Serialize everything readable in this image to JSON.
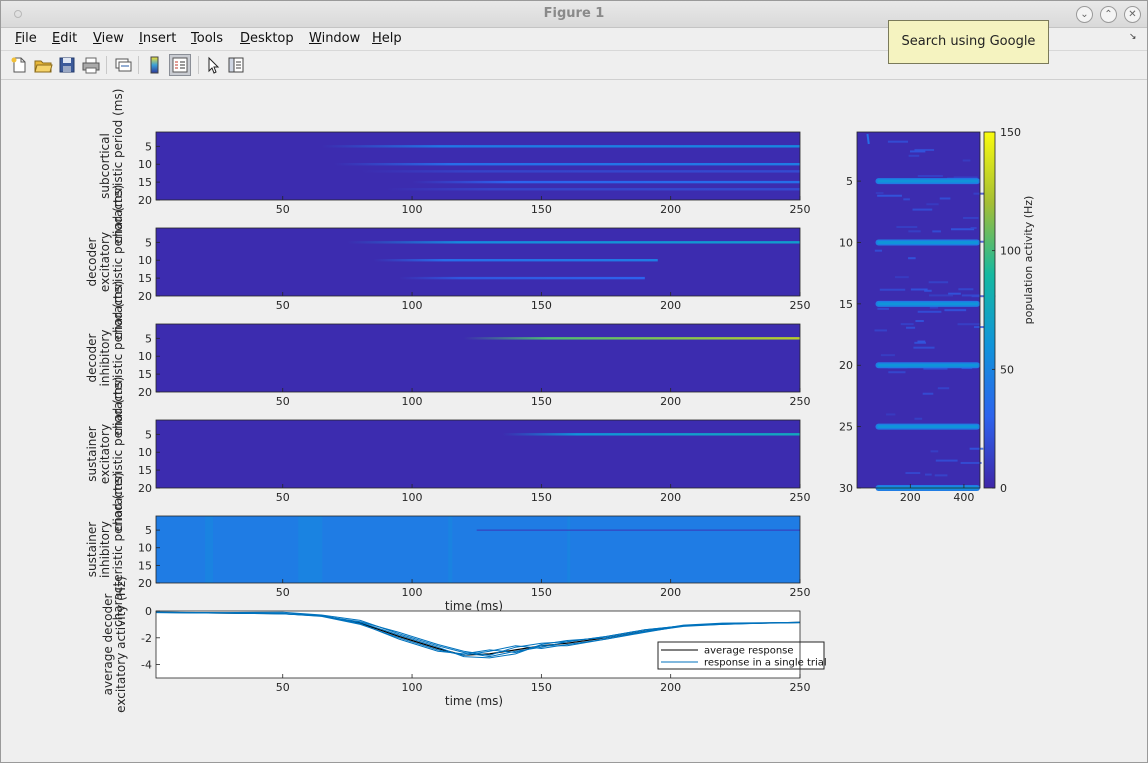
{
  "window": {
    "title": "Figure 1"
  },
  "menu": [
    {
      "label": "File",
      "u": "F",
      "rest": "ile"
    },
    {
      "label": "Edit",
      "u": "E",
      "rest": "dit"
    },
    {
      "label": "View",
      "u": "V",
      "rest": "iew"
    },
    {
      "label": "Insert",
      "u": "I",
      "rest": "nsert"
    },
    {
      "label": "Tools",
      "u": "T",
      "rest": "ools"
    },
    {
      "label": "Desktop",
      "u": "D",
      "rest": "esktop"
    },
    {
      "label": "Window",
      "u": "W",
      "rest": "indow"
    },
    {
      "label": "Help",
      "u": "H",
      "rest": "elp"
    }
  ],
  "toolbar": [
    "new-figure-icon",
    "open-file-icon",
    "save-icon",
    "print-icon",
    "link-axes-icon",
    "colorbar-icon",
    "legend-icon",
    "edit-plot-arrow-icon",
    "property-inspector-icon"
  ],
  "tooltip": {
    "text": "Search using Google"
  },
  "colors": {
    "low": "#3e26a8",
    "high": "#f9fb0e",
    "line_avg": "#000000",
    "line_trial": "#0072bd"
  },
  "chart_data": [
    {
      "type": "heatmap",
      "ylabel": [
        "subcortical",
        "characteristic period (ms)"
      ],
      "x_ticks": [
        50,
        100,
        150,
        200,
        250
      ],
      "y_ticks": [
        5,
        10,
        15,
        20
      ],
      "xlim": [
        1,
        250
      ],
      "ylim": [
        20,
        1
      ],
      "bands": [
        {
          "y": 5,
          "x_start": 65,
          "x_end": 250,
          "level": 0.35
        },
        {
          "y": 10,
          "x_start": 70,
          "x_end": 250,
          "level": 0.3
        },
        {
          "y": 12,
          "x_start": 80,
          "x_end": 250,
          "level": 0.12
        },
        {
          "y": 15,
          "x_start": 100,
          "x_end": 250,
          "level": 0.25
        },
        {
          "y": 17,
          "x_start": 90,
          "x_end": 250,
          "level": 0.12
        }
      ]
    },
    {
      "type": "heatmap",
      "ylabel": [
        "decoder",
        "excitatory",
        "characteristic period (ms)"
      ],
      "x_ticks": [
        50,
        100,
        150,
        200,
        250
      ],
      "y_ticks": [
        5,
        10,
        15,
        20
      ],
      "xlim": [
        1,
        250
      ],
      "ylim": [
        20,
        1
      ],
      "bands": [
        {
          "y": 5,
          "x_start": 75,
          "x_end": 250,
          "level": 0.45
        },
        {
          "y": 10,
          "x_start": 85,
          "x_end": 195,
          "level": 0.3
        },
        {
          "y": 15,
          "x_start": 95,
          "x_end": 190,
          "level": 0.2
        }
      ]
    },
    {
      "type": "heatmap",
      "ylabel": [
        "decoder",
        "inhibitory",
        "characteristic period (ms)"
      ],
      "x_ticks": [
        50,
        100,
        150,
        200,
        250
      ],
      "y_ticks": [
        5,
        10,
        15,
        20
      ],
      "xlim": [
        1,
        250
      ],
      "ylim": [
        20,
        1
      ],
      "bands": [
        {
          "y": 5,
          "x_start": 120,
          "x_end": 250,
          "level": 0.85
        }
      ]
    },
    {
      "type": "heatmap",
      "ylabel": [
        "sustainer",
        "excitatory",
        "characteristic period (ms)"
      ],
      "x_ticks": [
        50,
        100,
        150,
        200,
        250
      ],
      "y_ticks": [
        5,
        10,
        15,
        20
      ],
      "xlim": [
        1,
        250
      ],
      "ylim": [
        20,
        1
      ],
      "bands": [
        {
          "y": 5,
          "x_start": 135,
          "x_end": 250,
          "level": 0.5
        }
      ]
    },
    {
      "type": "heatmap",
      "ylabel": [
        "sustainer",
        "inhibitory",
        "characteristic period (ms)"
      ],
      "xlabel": "time (ms)",
      "x_ticks": [
        50,
        100,
        150,
        200,
        250
      ],
      "y_ticks": [
        5,
        10,
        15,
        20
      ],
      "xlim": [
        1,
        250
      ],
      "ylim": [
        20,
        1
      ],
      "background_level": 0.3
    },
    {
      "type": "line",
      "ylabel": [
        "average decoder",
        "excitatory activity (Hz)"
      ],
      "xlabel": "time (ms)",
      "x_ticks": [
        50,
        100,
        150,
        200,
        250
      ],
      "y_ticks": [
        0,
        -2,
        -4
      ],
      "xlim": [
        1,
        250
      ],
      "ylim": [
        -5,
        0
      ],
      "legend": {
        "position": "lower-right",
        "entries": [
          "average response",
          "response in a single trial"
        ]
      },
      "x": [
        1,
        25,
        50,
        65,
        80,
        95,
        110,
        120,
        130,
        140,
        150,
        160,
        175,
        190,
        205,
        220,
        235,
        250
      ],
      "series": [
        {
          "name": "average response",
          "values": [
            -0.1,
            -0.15,
            -0.2,
            -0.35,
            -0.9,
            -1.9,
            -2.8,
            -3.3,
            -3.2,
            -2.9,
            -2.6,
            -2.4,
            -2.0,
            -1.5,
            -1.1,
            -0.95,
            -0.9,
            -0.85
          ]
        },
        {
          "name": "response in a single trial",
          "values": [
            -0.1,
            -0.12,
            -0.1,
            -0.3,
            -0.7,
            -1.7,
            -2.6,
            -3.1,
            -3.4,
            -3.0,
            -2.7,
            -2.3,
            -1.9,
            -1.4,
            -1.1,
            -0.95,
            -0.9,
            -0.85
          ]
        },
        {
          "values": [
            -0.12,
            -0.15,
            -0.2,
            -0.4,
            -1.0,
            -2.0,
            -2.9,
            -3.3,
            -3.0,
            -2.6,
            -2.8,
            -2.5,
            -2.1,
            -1.6,
            -1.1,
            -1.0,
            -0.92,
            -0.88
          ]
        },
        {
          "values": [
            -0.1,
            -0.14,
            -0.22,
            -0.35,
            -0.85,
            -1.8,
            -2.7,
            -3.4,
            -3.5,
            -3.2,
            -2.5,
            -2.2,
            -2.0,
            -1.5,
            -1.05,
            -0.9,
            -0.88,
            -0.85
          ]
        },
        {
          "values": [
            -0.11,
            -0.16,
            -0.18,
            -0.33,
            -0.95,
            -2.1,
            -3.0,
            -3.2,
            -2.9,
            -3.1,
            -2.6,
            -2.6,
            -2.1,
            -1.55,
            -1.15,
            -1.0,
            -0.9,
            -0.86
          ]
        },
        {
          "values": [
            -0.1,
            -0.13,
            -0.2,
            -0.38,
            -0.8,
            -1.6,
            -2.5,
            -3.0,
            -3.3,
            -2.7,
            -2.4,
            -2.3,
            -1.9,
            -1.4,
            -1.1,
            -0.97,
            -0.9,
            -0.84
          ]
        }
      ]
    },
    {
      "type": "heatmap",
      "ylabel": [],
      "x_ticks": [
        200,
        400
      ],
      "y_ticks": [
        5,
        10,
        15,
        20,
        25,
        30
      ],
      "xlim": [
        1,
        460
      ],
      "ylim": [
        30,
        1
      ],
      "rows_bright": [
        5,
        10,
        15,
        20,
        25,
        30
      ],
      "bright_from_x": 70,
      "colorbar": {
        "label": "population activity (Hz)",
        "ticks": [
          0,
          50,
          100,
          150
        ],
        "range": [
          0,
          150
        ]
      }
    }
  ]
}
